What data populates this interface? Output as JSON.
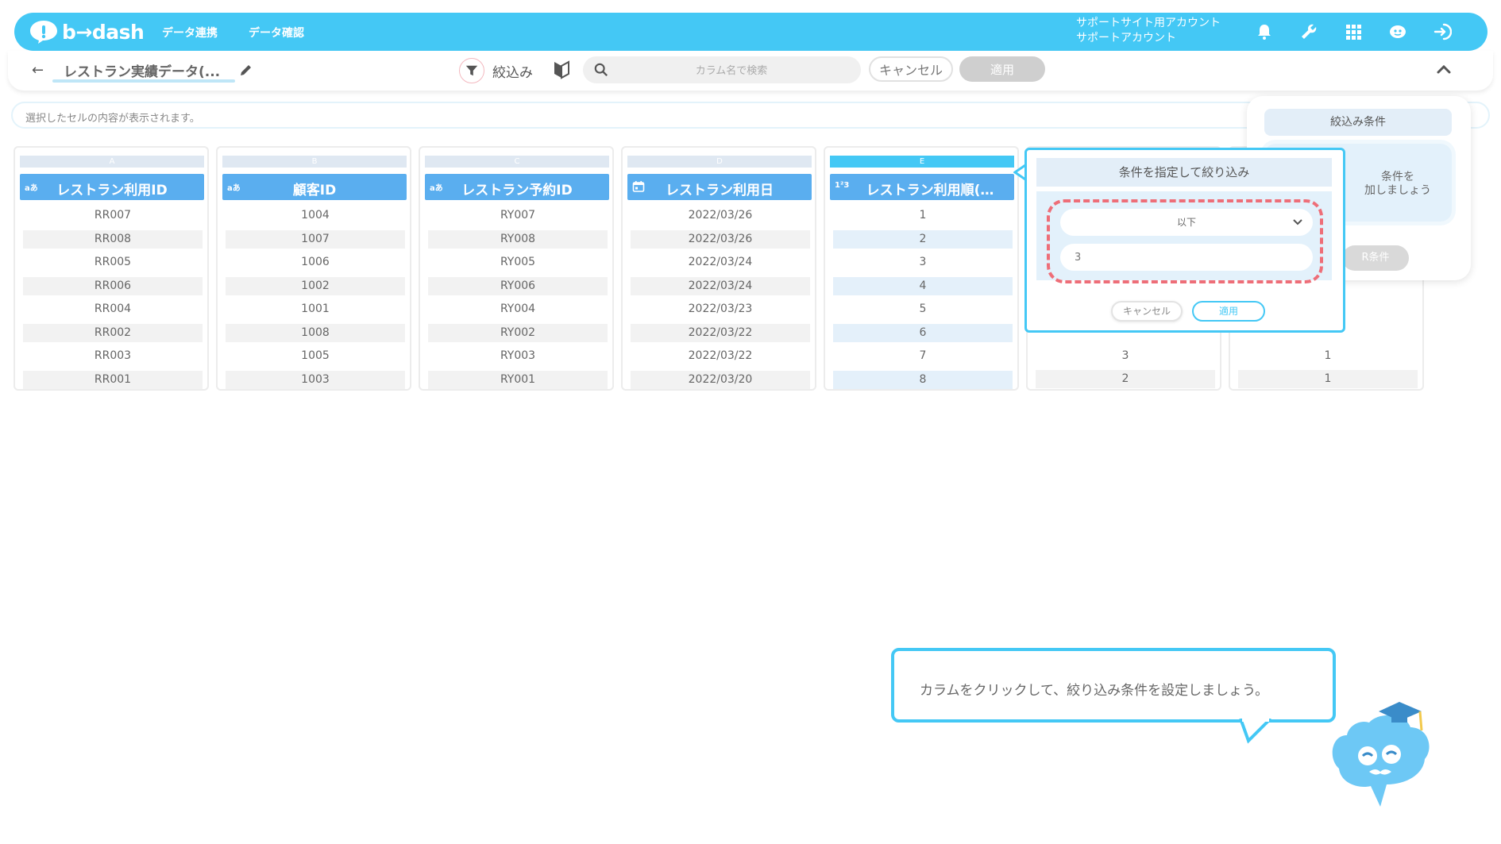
{
  "header": {
    "logo_text": "b→dash",
    "nav": [
      "データ連携",
      "データ確認"
    ],
    "account_line1": "サポートサイト用アカウント",
    "account_line2": "サポートアカウント",
    "icons": [
      "bell-icon",
      "wrench-icon",
      "apps-grid-icon",
      "mascot-chat-icon",
      "logout-icon"
    ]
  },
  "toolbar": {
    "sheet_title": "レストラン実績データ(...",
    "filter_label": "絞込み",
    "search_placeholder": "カラム名で検索",
    "cancel_label": "キャンセル",
    "apply_label": "適用"
  },
  "cellbar": {
    "placeholder": "選択したセルの内容が表示されます。"
  },
  "columns": [
    {
      "letter": "A",
      "type": "aあ",
      "name": "レストラン利用ID",
      "cells": [
        "RR007",
        "RR008",
        "RR005",
        "RR006",
        "RR004",
        "RR002",
        "RR003",
        "RR001"
      ]
    },
    {
      "letter": "B",
      "type": "aあ",
      "name": "顧客ID",
      "cells": [
        "1004",
        "1007",
        "1006",
        "1002",
        "1001",
        "1008",
        "1005",
        "1003"
      ]
    },
    {
      "letter": "C",
      "type": "aあ",
      "name": "レストラン予約ID",
      "cells": [
        "RY007",
        "RY008",
        "RY005",
        "RY006",
        "RY004",
        "RY002",
        "RY003",
        "RY001"
      ]
    },
    {
      "letter": "D",
      "type": "calendar",
      "name": "レストラン利用日",
      "cells": [
        "2022/03/26",
        "2022/03/26",
        "2022/03/24",
        "2022/03/24",
        "2022/03/23",
        "2022/03/22",
        "2022/03/22",
        "2022/03/20"
      ]
    },
    {
      "letter": "E",
      "type": "1²3",
      "name": "レストラン利用順(…",
      "cells": [
        "1",
        "2",
        "3",
        "4",
        "5",
        "6",
        "7",
        "8"
      ]
    }
  ],
  "hidden_columns": {
    "F_visible_cells": [
      "3",
      "2"
    ],
    "G_visible_cells": [
      "1",
      "1"
    ]
  },
  "filter_panel": {
    "title": "絞込み条件",
    "card_text_line1": "条件を",
    "card_text_line2": "加しましょう",
    "or_button": "R条件"
  },
  "popup": {
    "title": "条件を指定して絞り込み",
    "operator": "以下",
    "value": "3",
    "cancel_label": "キャンセル",
    "apply_label": "適用"
  },
  "hint": {
    "text": "カラムをクリックして、絞り込み条件を設定しましょう。"
  },
  "colors": {
    "accent": "#44c8f5",
    "header_blue": "#5aaeef",
    "highlight_red": "#ee6e78"
  }
}
